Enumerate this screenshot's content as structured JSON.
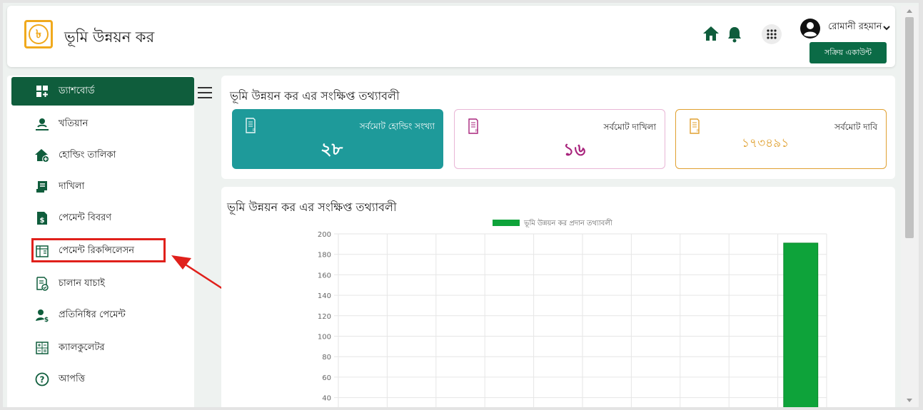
{
  "header": {
    "logo_glyph": "৳",
    "app_title": "ভূমি উন্নয়ন কর",
    "user_name": "রোমানী রহমান",
    "account_button": "সক্রিয় একাউন্ট",
    "icons": [
      "home-icon",
      "bell-icon",
      "apps-grid-icon",
      "user-avatar-icon",
      "chevron-down-icon"
    ]
  },
  "sidebar": {
    "items": [
      {
        "label": "ড্যাশবোর্ড",
        "icon": "dashboard-icon",
        "active": true
      },
      {
        "label": "খতিয়ান",
        "icon": "person-pin-icon"
      },
      {
        "label": "হোল্ডিং তালিকা",
        "icon": "house-add-icon"
      },
      {
        "label": "দাখিলা",
        "icon": "receipt-icon"
      },
      {
        "label": "পেমেন্ট বিবরণ",
        "icon": "payment-doc-icon"
      },
      {
        "label": "পেমেন্ট রিকন্সিলেসন",
        "icon": "reconcile-icon"
      },
      {
        "label": "চালান যাচাই",
        "icon": "challan-check-icon"
      },
      {
        "label": "প্রতিনিধির পেমেন্ট",
        "icon": "agent-payment-icon"
      },
      {
        "label": "ক্যালকুলেটর",
        "icon": "calculator-icon"
      },
      {
        "label": "আপত্তি",
        "icon": "question-icon"
      }
    ]
  },
  "summary": {
    "title": "ভূমি উন্নয়ন কর এর সংক্ষিপ্ত তথ্যাবলী",
    "stats": [
      {
        "label": "সর্বমোট হোল্ডিং সংখ্যা",
        "value": "২৮"
      },
      {
        "label": "সর্বমোট দাখিলা",
        "value": "১৬"
      },
      {
        "label": "সর্বমোট দাবি",
        "value": "১৭৩৪৯১"
      }
    ]
  },
  "chart_section": {
    "title": "ভূমি উন্নয়ন কর এর সংক্ষিপ্ত তথ্যাবলী"
  },
  "chart_data": {
    "type": "bar",
    "legend": "ভূমি উন্নয়ন কর প্রদান তথ্যাবলী",
    "legend_position": "top",
    "yticks": [
      "200",
      "180",
      "160",
      "140",
      "120",
      "100",
      "80",
      "60",
      "40"
    ],
    "ylim": [
      40,
      200
    ],
    "categories_count": 10,
    "values": [
      0,
      0,
      0,
      0,
      0,
      0,
      0,
      0,
      0,
      191
    ],
    "grid": true,
    "color": "#0ea33a"
  },
  "colors": {
    "brand_green": "#0f5d3c",
    "teal": "#1e9a9a",
    "magenta": "#a8247c",
    "orange": "#e0a030",
    "highlight_red": "#e0201b"
  }
}
